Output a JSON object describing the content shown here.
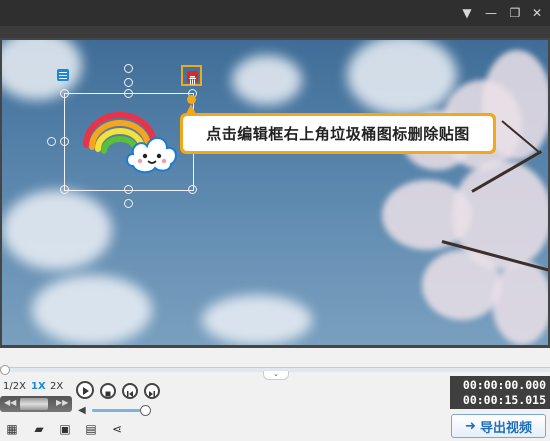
{
  "titlebar": {
    "icons": [
      "dropdown-arrow-icon",
      "minimize-icon",
      "restore-icon",
      "close-icon"
    ]
  },
  "editor": {
    "tooltip_text": "点击编辑框右上角垃圾桶图标删除贴图",
    "sticker": "rainbow-with-cloud",
    "tooltip_accent": "#f2a817",
    "delete_icon_color": "#d82828",
    "list_icon_color": "#1a8ad8"
  },
  "playback": {
    "speeds": [
      "1/2X",
      "1X",
      "2X"
    ],
    "selected_speed": "1X",
    "current_time": "00:00:00.000",
    "total_time": "00:00:15.015",
    "progress": 0.0,
    "volume": 0.9,
    "controls": [
      "play-icon",
      "stop-icon",
      "previous-frame-icon",
      "next-frame-icon"
    ]
  },
  "toolbar": {
    "tools": [
      "new-icon",
      "open-folder-icon",
      "save-icon",
      "save-as-icon",
      "share-icon"
    ],
    "export_label": "导出视频",
    "export_color": "#1f6fb8"
  }
}
